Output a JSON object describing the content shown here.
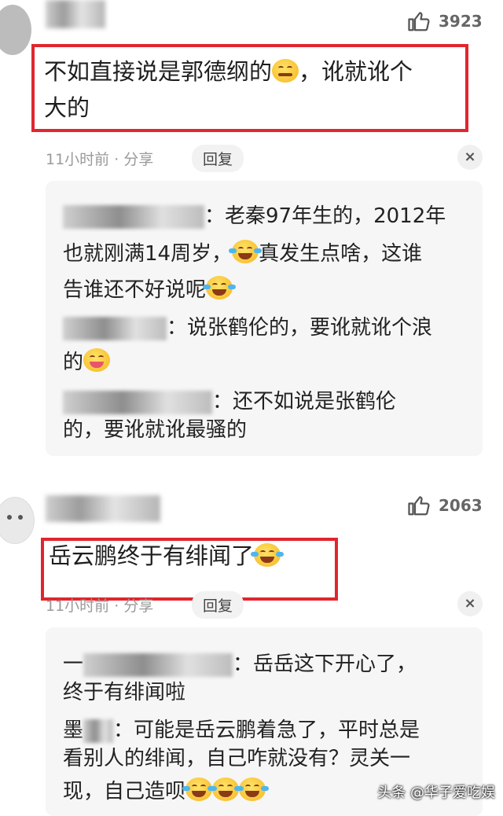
{
  "comments": [
    {
      "likes": "3923",
      "text_line1": "不如直接说是郭德纲的",
      "text_line1_tail": "，讹就讹个",
      "text_line2": "大的",
      "time_share": "11小时前 · 分享",
      "reply_label": "回复",
      "close_label": "×",
      "replies": [
        {
          "line1": "：老秦97年生的，2012年",
          "line2a": "也就刚满14周岁，",
          "line2b": "真发生点啥，这谁",
          "line3": "告谁还不好说呢"
        },
        {
          "line1": "：说张鹤伦的，要讹就讹个浪",
          "line2": "的"
        },
        {
          "line1": "：还不如说是张鹤伦",
          "line2": "的，要讹就讹最骚的"
        }
      ]
    },
    {
      "likes": "2063",
      "text": "岳云鹏终于有绯闻了",
      "time_share": "11小时前 · 分享",
      "reply_label": "回复",
      "close_label": "×",
      "replies": [
        {
          "line1a": "一",
          "line1": "：岳岳这下开心了，",
          "line2": "终于有绯闻啦"
        },
        {
          "line1a": "墨",
          "line1": "：可能是岳云鹏着急了，平时总是",
          "line2": "看别人的绯闻，自己咋就没有？灵关一",
          "line3": "现，自己造呗"
        }
      ]
    }
  ],
  "icons": {
    "like": "thumbs-up-icon",
    "close": "close-icon",
    "emoji_laugh": "laugh-cry-emoji-icon",
    "emoji_smirk": "smirk-emoji-icon"
  },
  "colors": {
    "highlight_box": "#e0262e",
    "panel_bg": "#f6f6f6"
  },
  "watermark": "头条 @华子爱吃娱"
}
